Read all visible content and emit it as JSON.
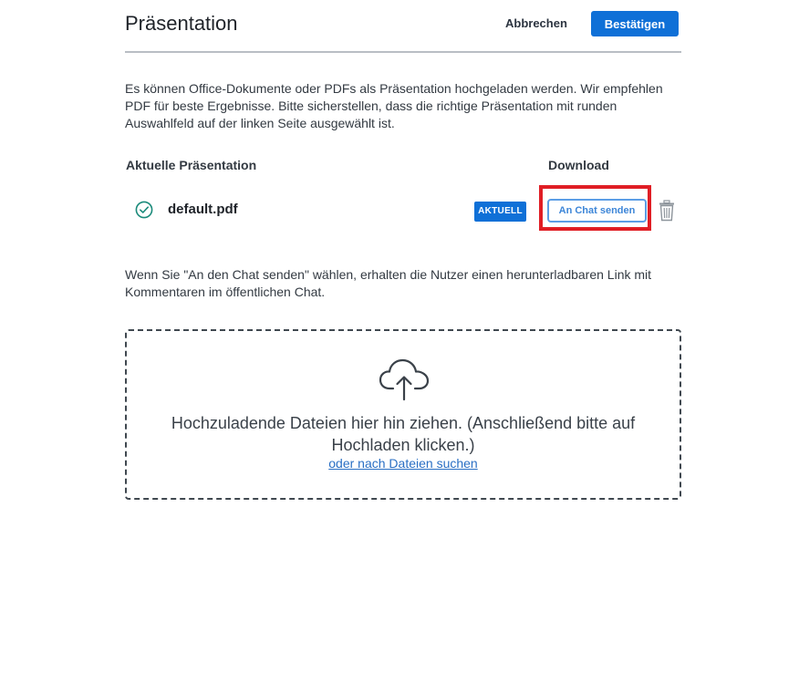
{
  "header": {
    "title": "Präsentation",
    "cancel_label": "Abbrechen",
    "confirm_label": "Bestätigen"
  },
  "intro_text": "Es können Office-Dokumente oder PDFs als Präsentation hochgeladen werden. Wir empfehlen PDF für beste Ergebnisse. Bitte sicherstellen, dass die richtige Präsentation mit runden Auswahlfeld auf der linken Seite ausgewählt ist.",
  "table": {
    "col_current": "Aktuelle Präsentation",
    "col_download": "Download",
    "rows": [
      {
        "filename": "default.pdf",
        "badge": "AKTUELL",
        "send_label": "An Chat senden",
        "status_icon": "check-circle-icon",
        "delete_icon": "trash-icon"
      }
    ]
  },
  "note_text": "Wenn Sie \"An den Chat senden\" wählen, erhalten die Nutzer einen herunterladbaren Link mit Kommentaren im öffentlichen Chat.",
  "dropzone": {
    "icon": "cloud-upload-icon",
    "text": "Hochzuladende Dateien hier hin ziehen. (Anschließend bitte auf Hochladen klicken.)",
    "link": "oder nach Dateien suchen"
  },
  "colors": {
    "accent": "#0f70d7",
    "highlight": "#e01e25",
    "success": "#1a8a7a"
  }
}
